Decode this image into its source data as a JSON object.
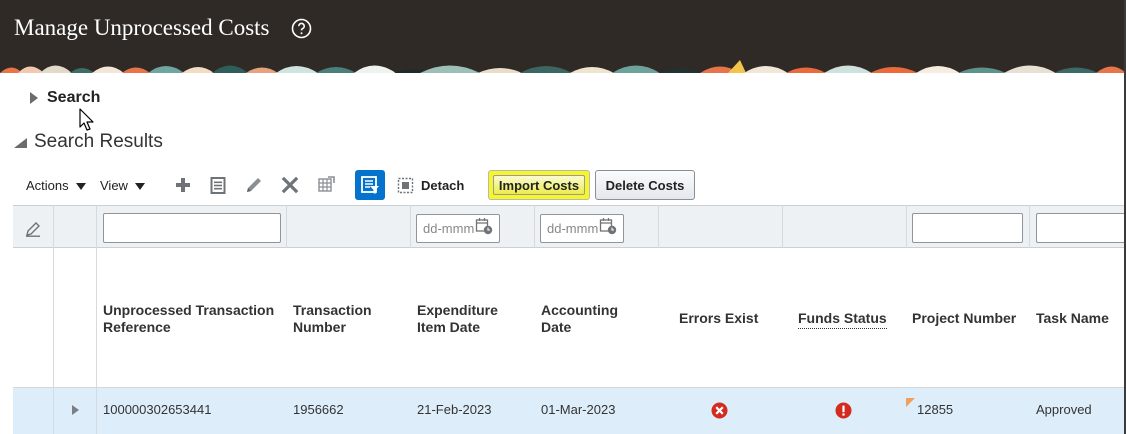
{
  "header": {
    "title": "Manage Unprocessed Costs",
    "help_icon": "help-circle-icon"
  },
  "search": {
    "label": "Search",
    "expanded": false
  },
  "results": {
    "label": "Search Results",
    "expanded": true
  },
  "toolbar": {
    "actions_label": "Actions",
    "view_label": "View",
    "icons": [
      "add-icon",
      "details-icon",
      "edit-icon",
      "delete-icon",
      "export-icon",
      "freeze-icon"
    ],
    "detach_label": "Detach",
    "import_label": "Import Costs",
    "delete_label": "Delete Costs"
  },
  "filters": {
    "expenditure_date_placeholder": "dd-mmm",
    "accounting_date_placeholder": "dd-mmm"
  },
  "columns": [
    {
      "key": "reference",
      "label": "Unprocessed Transaction Reference"
    },
    {
      "key": "transaction_number",
      "label": "Transaction Number"
    },
    {
      "key": "expenditure_date",
      "label": "Expenditure Item Date"
    },
    {
      "key": "accounting_date",
      "label": "Accounting Date"
    },
    {
      "key": "errors",
      "label": "Errors Exist"
    },
    {
      "key": "funds",
      "label": "Funds Status"
    },
    {
      "key": "project",
      "label": "Project Number"
    },
    {
      "key": "task",
      "label": "Task Name"
    }
  ],
  "rows": [
    {
      "reference": "100000302653441",
      "transaction_number": "1956662",
      "expenditure_date": "21-Feb-2023",
      "accounting_date": "01-Mar-2023",
      "errors_icon": "error-x-icon",
      "funds_icon": "warning-exclamation-icon",
      "project": "12855",
      "task": "Approved"
    }
  ],
  "colors": {
    "header_bg": "#2f2a26",
    "accent": "#0572ce",
    "highlight": "#f6f62a",
    "row_selected": "#ddeefa",
    "error": "#d42b21"
  }
}
